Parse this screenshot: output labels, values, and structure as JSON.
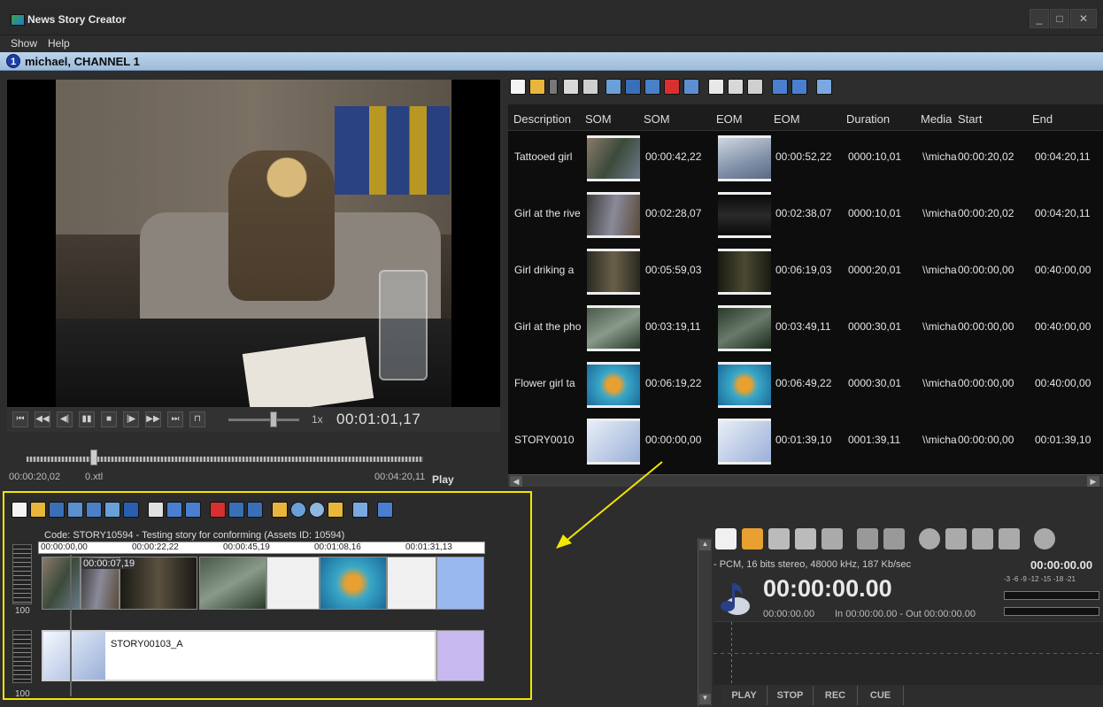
{
  "window": {
    "title": "News Story Creator",
    "min": "_",
    "max": "□",
    "close": "✕"
  },
  "menu": {
    "show": "Show",
    "help": "Help"
  },
  "channel": {
    "number": "1",
    "name": "michael, CHANNEL 1"
  },
  "player": {
    "speed": "1x",
    "timecode": "00:01:01,17",
    "in_time": "00:00:20,02",
    "speed_text": "0.xtl",
    "out_time": "00:04:20,11",
    "state": "Play"
  },
  "table": {
    "columns": [
      "Description",
      "SOM",
      "SOM",
      "EOM",
      "EOM",
      "Duration",
      "Media",
      "Start",
      "End"
    ],
    "rows": [
      {
        "description": "Tattooed girl",
        "som": "00:00:42,22",
        "eom": "00:00:52,22",
        "duration": "0000:10,01",
        "media": "\\\\micha",
        "start": "00:00:20,02",
        "end": "00:04:20,11"
      },
      {
        "description": "Girl at the rive",
        "som": "00:02:28,07",
        "eom": "00:02:38,07",
        "duration": "0000:10,01",
        "media": "\\\\micha",
        "start": "00:00:20,02",
        "end": "00:04:20,11"
      },
      {
        "description": "Girl driking a",
        "som": "00:05:59,03",
        "eom": "00:06:19,03",
        "duration": "0000:20,01",
        "media": "\\\\micha",
        "start": "00:00:00,00",
        "end": "00:40:00,00"
      },
      {
        "description": "Girl at the pho",
        "som": "00:03:19,11",
        "eom": "00:03:49,11",
        "duration": "0000:30,01",
        "media": "\\\\micha",
        "start": "00:00:00,00",
        "end": "00:40:00,00"
      },
      {
        "description": "Flower girl ta",
        "som": "00:06:19,22",
        "eom": "00:06:49,22",
        "duration": "0000:30,01",
        "media": "\\\\micha",
        "start": "00:00:00,00",
        "end": "00:40:00,00"
      },
      {
        "description": "STORY0010",
        "som": "00:00:00,00",
        "eom": "00:01:39,10",
        "duration": "0001:39,11",
        "media": "\\\\micha",
        "start": "00:00:00,00",
        "end": "00:01:39,10"
      }
    ]
  },
  "timeline": {
    "code": "Code: STORY10594 - Testing story for conforming (Assets ID: 10594)",
    "ruler": [
      "00:00:00,00",
      "00:00:22,22",
      "00:00:45,19",
      "00:01:08,16",
      "00:01:31,13"
    ],
    "marker": "00:00:07,19",
    "video_vol": "100",
    "audio_vol": "100",
    "audio_clip": "STORY00103_A"
  },
  "audio": {
    "info": "- PCM, 16 bits stereo, 48000 kHz, 187 Kb/sec",
    "timecode_small": "00:00:00.00",
    "timecode_big": "00:00:00.00",
    "timecode_sub": "00:00:00.00",
    "inout": "In 00:00:00.00 - Out 00:00:00.00",
    "meter_scale": "-3  -6  -9  -12  -15  -18  -21",
    "play": "PLAY",
    "stop": "STOP",
    "rec": "REC",
    "cue": "CUE"
  }
}
